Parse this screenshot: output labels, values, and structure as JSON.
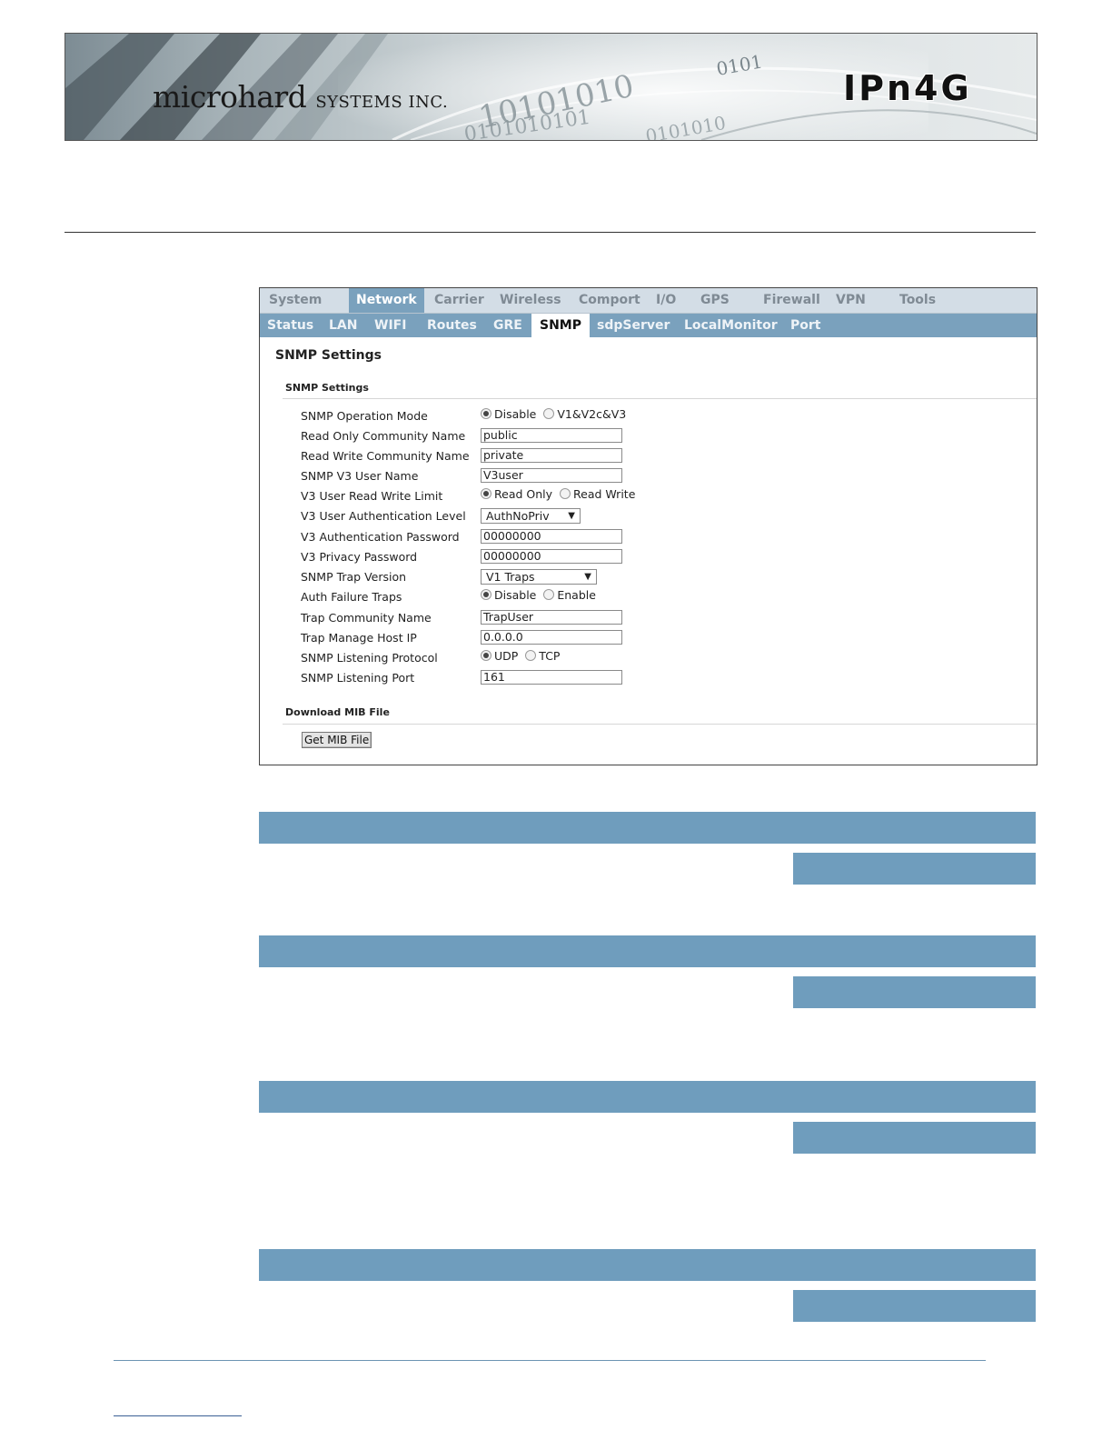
{
  "banner": {
    "brand_main": "microhard",
    "brand_sub": "SYSTEMS INC.",
    "model": "IPn4G",
    "binary_top": "0101",
    "binary_line1": "10101010",
    "binary_line2": "0101010101",
    "binary_line3": "0101010"
  },
  "main_tabs": [
    {
      "label": "System"
    },
    {
      "label": "Network"
    },
    {
      "label": "Carrier"
    },
    {
      "label": "Wireless"
    },
    {
      "label": "Comport"
    },
    {
      "label": "I/O"
    },
    {
      "label": "GPS"
    },
    {
      "label": "Firewall"
    },
    {
      "label": "VPN"
    },
    {
      "label": "Tools"
    }
  ],
  "main_tab_active": "Network",
  "sub_tabs": [
    {
      "label": "Status"
    },
    {
      "label": "LAN"
    },
    {
      "label": "WIFI"
    },
    {
      "label": "Routes"
    },
    {
      "label": "GRE"
    },
    {
      "label": "SNMP"
    },
    {
      "label": "sdpServer"
    },
    {
      "label": "LocalMonitor"
    },
    {
      "label": "Port"
    }
  ],
  "sub_tab_active": "SNMP",
  "page_title": "SNMP Settings",
  "section_snmp": "SNMP Settings",
  "fields": {
    "operation_mode": {
      "label": "SNMP Operation Mode",
      "options": [
        "Disable",
        "V1&V2c&V3"
      ],
      "selected": "Disable"
    },
    "ro_community": {
      "label": "Read Only Community Name",
      "value": "public"
    },
    "rw_community": {
      "label": "Read Write Community Name",
      "value": "private"
    },
    "v3_user": {
      "label": "SNMP V3 User Name",
      "value": "V3user"
    },
    "v3_rw_limit": {
      "label": "V3 User Read Write Limit",
      "options": [
        "Read Only",
        "Read Write"
      ],
      "selected": "Read Only"
    },
    "v3_auth_level": {
      "label": "V3 User Authentication Level",
      "value": "AuthNoPriv"
    },
    "v3_auth_password": {
      "label": "V3 Authentication Password",
      "value": "00000000"
    },
    "v3_privacy_password": {
      "label": "V3 Privacy Password",
      "value": "00000000"
    },
    "trap_version": {
      "label": "SNMP Trap Version",
      "value": "V1 Traps"
    },
    "auth_failure_traps": {
      "label": "Auth Failure Traps",
      "options": [
        "Disable",
        "Enable"
      ],
      "selected": "Disable"
    },
    "trap_community": {
      "label": "Trap Community Name",
      "value": "TrapUser"
    },
    "trap_host_ip": {
      "label": "Trap Manage Host IP",
      "value": "0.0.0.0"
    },
    "listen_protocol": {
      "label": "SNMP Listening Protocol",
      "options": [
        "UDP",
        "TCP"
      ],
      "selected": "UDP"
    },
    "listen_port": {
      "label": "SNMP Listening Port",
      "value": "161"
    }
  },
  "section_mib": "Download MIB File",
  "get_mib_button": "Get MIB File",
  "colors": {
    "tab_bar": "#d3dde6",
    "accent_blue": "#7aa1bd",
    "bar_blue": "#6f9dbd"
  }
}
